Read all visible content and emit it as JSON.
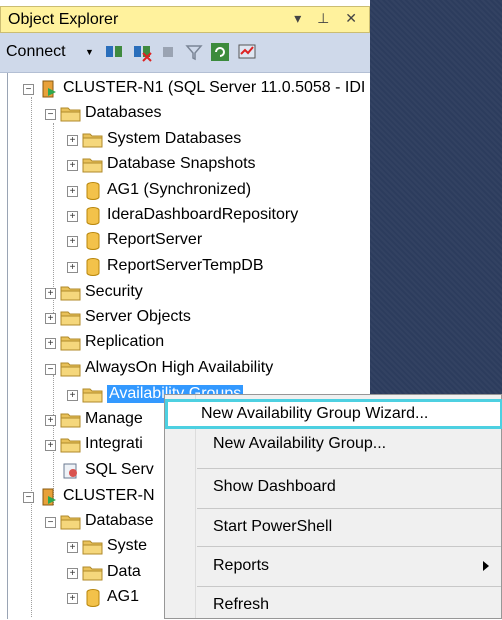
{
  "panel": {
    "title": "Object Explorer",
    "title_buttons": "▾ ⊥ ✕",
    "connect_label": "Connect"
  },
  "tree": [
    {
      "label": "CLUSTER-N1 (SQL Server 11.0.5058 - IDI",
      "icon": "server-icon",
      "expander": "−"
    },
    {
      "label": "Databases",
      "icon": "folder-icon",
      "expander": "−"
    },
    {
      "label": "System Databases",
      "icon": "folder-icon",
      "expander": "+"
    },
    {
      "label": "Database Snapshots",
      "icon": "folder-icon",
      "expander": "+"
    },
    {
      "label": "AG1 (Synchronized)",
      "icon": "database-icon",
      "expander": "+"
    },
    {
      "label": "IderaDashboardRepository",
      "icon": "database-icon",
      "expander": "+"
    },
    {
      "label": "ReportServer",
      "icon": "database-icon",
      "expander": "+"
    },
    {
      "label": "ReportServerTempDB",
      "icon": "database-icon",
      "expander": "+"
    },
    {
      "label": "Security",
      "icon": "folder-icon",
      "expander": "+"
    },
    {
      "label": "Server Objects",
      "icon": "folder-icon",
      "expander": "+"
    },
    {
      "label": "Replication",
      "icon": "folder-icon",
      "expander": "+"
    },
    {
      "label": "AlwaysOn High Availability",
      "icon": "folder-icon",
      "expander": "−"
    },
    {
      "label": "Availability Groups",
      "icon": "folder-icon",
      "expander": "+",
      "selected": true
    },
    {
      "label": "Manage",
      "icon": "folder-icon",
      "expander": "+"
    },
    {
      "label": "Integrati",
      "icon": "folder-icon",
      "expander": "+"
    },
    {
      "label": "SQL Serv",
      "icon": "agent-icon",
      "expander": ""
    },
    {
      "label": "CLUSTER-N",
      "icon": "server-icon",
      "expander": "−"
    },
    {
      "label": "Database",
      "icon": "folder-icon",
      "expander": "−"
    },
    {
      "label": "Syste",
      "icon": "folder-icon",
      "expander": "+"
    },
    {
      "label": "Data",
      "icon": "folder-icon",
      "expander": "+"
    },
    {
      "label": "AG1",
      "icon": "database-icon",
      "expander": "+"
    }
  ],
  "context_menu": {
    "items": [
      {
        "label": "New Availability Group Wizard...",
        "highlighted": true
      },
      {
        "label": "New Availability Group..."
      },
      {
        "label": "Show Dashboard"
      },
      {
        "label": "Start PowerShell"
      },
      {
        "label": "Reports",
        "submenu": true
      },
      {
        "label": "Refresh"
      }
    ]
  },
  "colors": {
    "title_bg": "#fff29d",
    "toolbar_bg": "#cfd9ea",
    "background_panel": "#2c3c5d",
    "selection": "#3399ff",
    "menu_highlight_border": "#4dd0e1"
  }
}
